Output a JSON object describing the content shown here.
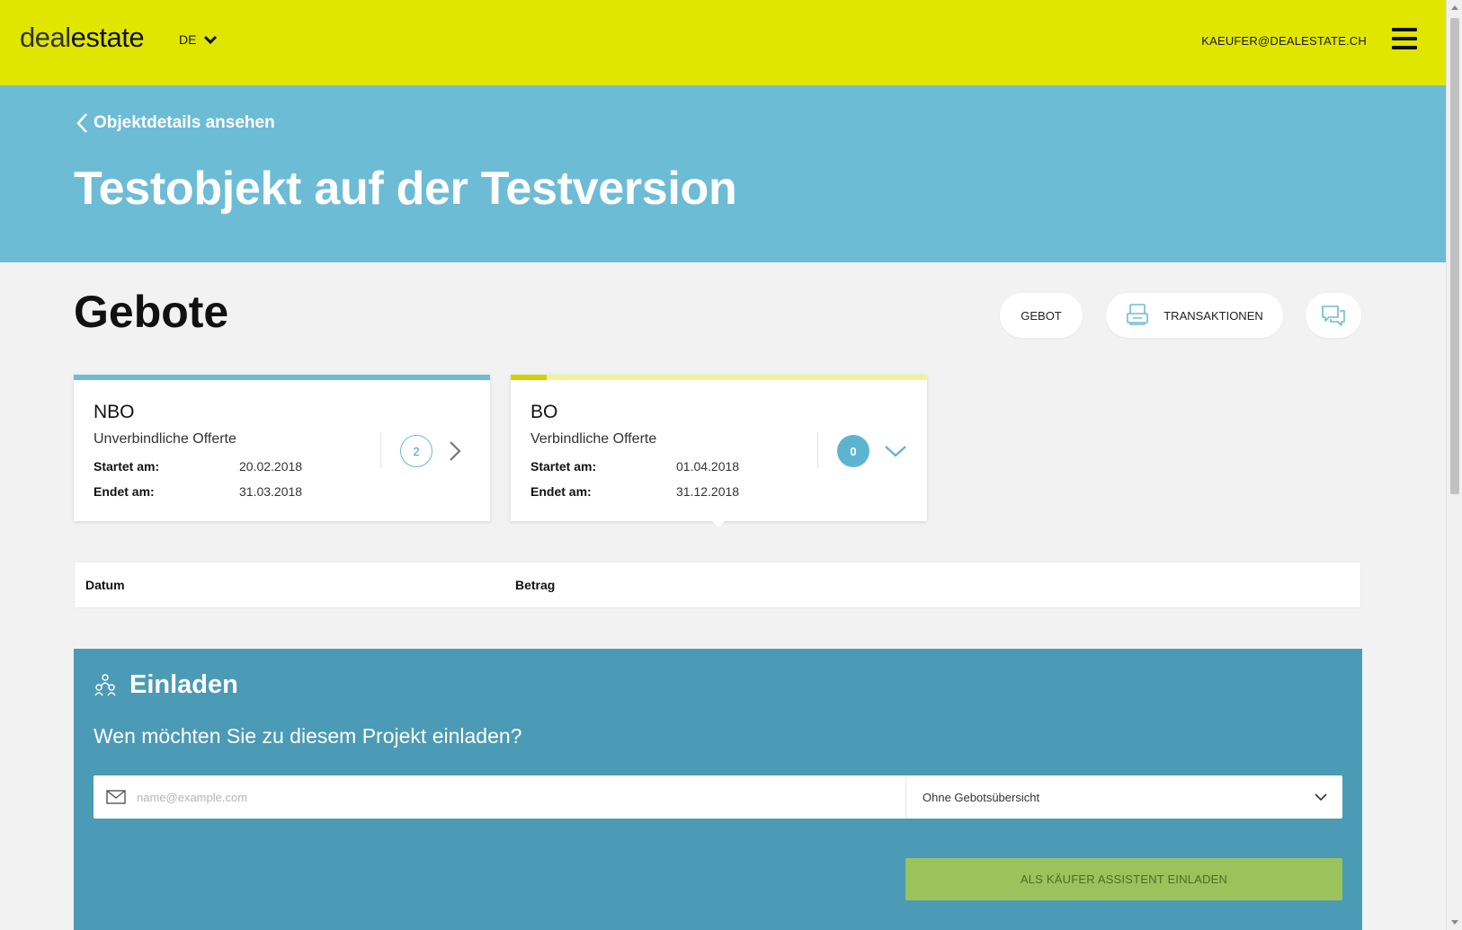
{
  "header": {
    "logo_light": "deal",
    "logo_bold": "estate",
    "language": "DE",
    "user_email": "KAEUFER@DEALESTATE.CH"
  },
  "hero": {
    "back_link": "Objektdetails ansehen",
    "title": "Testobjekt auf der Testversion"
  },
  "bids": {
    "section_title": "Gebote",
    "buttons": {
      "gebot": "GEBOT",
      "transaktionen": "TRANSAKTIONEN"
    },
    "cards": [
      {
        "name": "NBO",
        "subtitle": "Unverbindliche Offerte",
        "start_label": "Startet am:",
        "start_date": "20.02.2018",
        "end_label": "Endet am:",
        "end_date": "31.03.2018",
        "count": "2"
      },
      {
        "name": "BO",
        "subtitle": "Verbindliche Offerte",
        "start_label": "Startet am:",
        "start_date": "01.04.2018",
        "end_label": "Endet am:",
        "end_date": "31.12.2018",
        "count": "0"
      }
    ],
    "table": {
      "col_date": "Datum",
      "col_amount": "Betrag"
    }
  },
  "invite": {
    "title": "Einladen",
    "question": "Wen möchten Sie zu diesem Projekt einladen?",
    "email_placeholder": "name@example.com",
    "select_value": "Ohne Gebotsübersicht",
    "submit_label": "ALS KÄUFER ASSISTENT EINLADEN"
  },
  "colors": {
    "header_bg": "#e1e600",
    "hero_bg": "#6cbcd6",
    "invite_bg": "#4b9ab6",
    "invite_button": "#9cc25c"
  },
  "icons": [
    "chevron-down-icon",
    "menu-icon",
    "chevron-left-icon",
    "document-icon",
    "chat-icon",
    "chevron-right-icon",
    "people-icon",
    "envelope-icon"
  ]
}
